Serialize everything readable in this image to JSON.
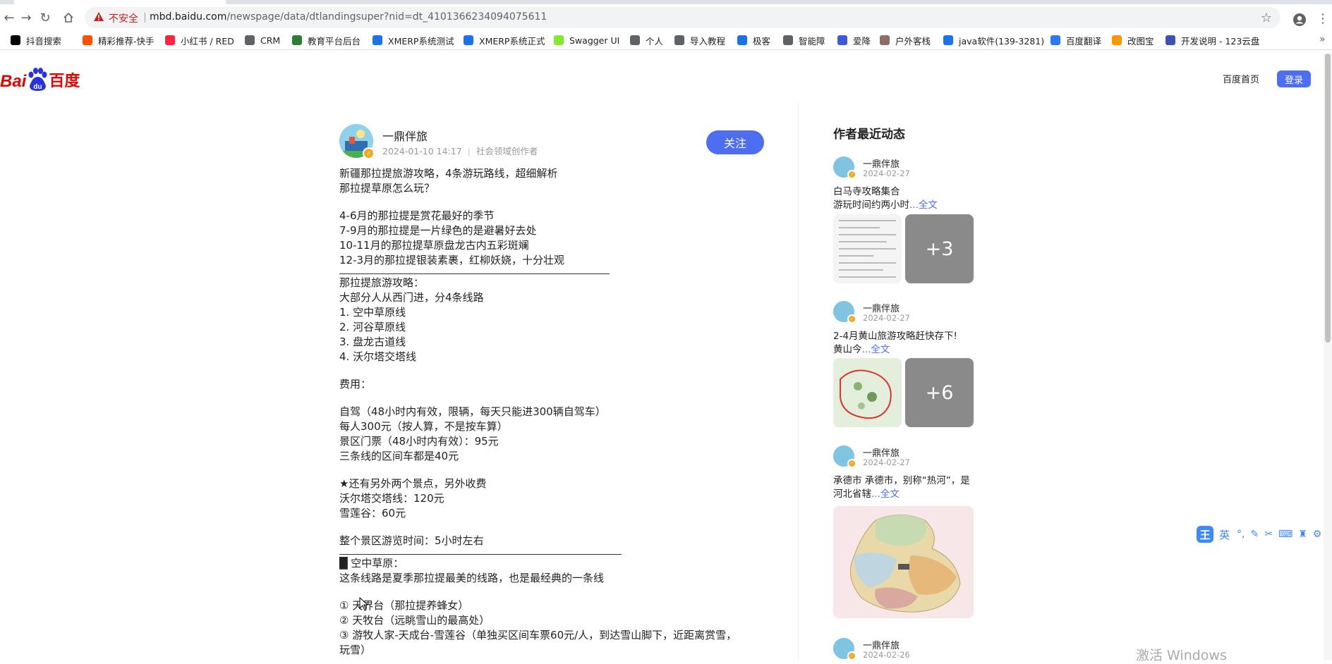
{
  "browser": {
    "insecure_label": "不安全",
    "url_host": "mbd.baidu.com",
    "url_path": "/newspage/data/dtlandingsuper?nid=dt_4101366234094075611",
    "bookmarks": [
      {
        "label": "抖音搜索",
        "icon": "tiktok-icon",
        "color": "#000000"
      },
      {
        "label": "精彩推荐-快手",
        "icon": "kuaishou-icon",
        "color": "#ff5000"
      },
      {
        "label": "小红书 / RED",
        "icon": "red-icon",
        "color": "#ff2442"
      },
      {
        "label": "CRM",
        "icon": "globe-icon",
        "color": "#5f6368"
      },
      {
        "label": "教育平台后台",
        "icon": "leaf-icon",
        "color": "#2e7d32"
      },
      {
        "label": "XMERP系统测试",
        "icon": "m-icon",
        "color": "#1a73e8"
      },
      {
        "label": "XMERP系统正式",
        "icon": "m-icon",
        "color": "#1a73e8"
      },
      {
        "label": "Swagger UI",
        "icon": "swagger-icon",
        "color": "#85ea2d"
      },
      {
        "label": "个人",
        "icon": "globe-icon",
        "color": "#5f6368"
      },
      {
        "label": "导入教程",
        "icon": "globe-icon",
        "color": "#5f6368"
      },
      {
        "label": "极客",
        "icon": "plane-icon",
        "color": "#1a73e8"
      },
      {
        "label": "智能障",
        "icon": "globe-icon",
        "color": "#5f6368"
      },
      {
        "label": "爱降",
        "icon": "face-icon",
        "color": "#3b5bdb"
      },
      {
        "label": "户外客栈",
        "icon": "camp-icon",
        "color": "#8d6e63"
      },
      {
        "label": "java软件(139-3281)",
        "icon": "calendar-icon",
        "color": "#1a73e8"
      },
      {
        "label": "百度翻译",
        "icon": "translate-icon",
        "color": "#2979ff"
      },
      {
        "label": "改图宝",
        "icon": "image-icon",
        "color": "#ff9800"
      },
      {
        "label": "开发说明 - 123云盘",
        "icon": "cloud-icon",
        "color": "#3f51b5"
      }
    ]
  },
  "header": {
    "logo_latin_1": "Bai",
    "logo_latin_2": "du",
    "logo_cn": "百度",
    "home_link": "百度首页",
    "login": "登录"
  },
  "author": {
    "name": "一鼎伴旅",
    "date": "2024-01-10 14:17",
    "role": "社会领域创作者",
    "follow": "关注"
  },
  "article_lines": [
    "新疆那拉提旅游攻略，4条游玩路线，超细解析",
    "那拉提草原怎么玩？",
    "",
    "4-6月的那拉提是赏花最好的季节",
    "7-9月的那拉提是一片绿色的是避暑好去处",
    "10-11月的那拉提草原盘龙古内五彩斑斓",
    "12-3月的那拉提银装素裹，红柳妖娆，十分壮观",
    "---",
    "那拉提旅游攻略：",
    "大部分人从西门进，分4条线路",
    "1. 空中草原线",
    "2. 河谷草原线",
    "3. 盘龙古道线",
    "4. 沃尔塔交塔线",
    "",
    "费用：",
    "",
    "自驾（48小时内有效，限辆，每天只能进300辆自驾车）",
    "每人300元（按人算，不是按车算）",
    "景区门票（48小时内有效）：95元",
    "三条线的区间车都是40元",
    "",
    "★还有另外两个景点，另外收费",
    "沃尔塔交塔线：120元",
    "雪莲谷：60元",
    "",
    "整个景区游览时间：5小时左右",
    "---",
    "█ 空中草原：",
    "这条线路是夏季那拉提最美的线路，也是最经典的一条线",
    "",
    "① 天界台（那拉提养蜂女）",
    "② 天牧台（远眺雪山的最高处）",
    "③ 游牧人家-天成台-雪莲谷（单独买区间车票60元/人，到达雪山脚下，近距离赏雪，",
    "玩雪）"
  ],
  "sidebar": {
    "title": "作者最近动态",
    "items": [
      {
        "name": "一鼎伴旅",
        "date": "2024-02-27",
        "line1": "白马寺攻略集合",
        "line2": "游玩时间约两小时",
        "more": "...全文",
        "extra": "+3"
      },
      {
        "name": "一鼎伴旅",
        "date": "2024-02-27",
        "line1": "2-4月黄山旅游攻略赶快存下!",
        "line2": "黄山今",
        "more": "...全文",
        "extra": "+6"
      },
      {
        "name": "一鼎伴旅",
        "date": "2024-02-27",
        "line1": "承德市 承德市，别称“热河”，是",
        "line2": "河北省辖",
        "more": "...全文"
      },
      {
        "name": "一鼎伴旅",
        "date": "2024-02-26"
      }
    ]
  },
  "ime": {
    "logo": "王",
    "lang": "英"
  },
  "watermark": "激活 Windows"
}
